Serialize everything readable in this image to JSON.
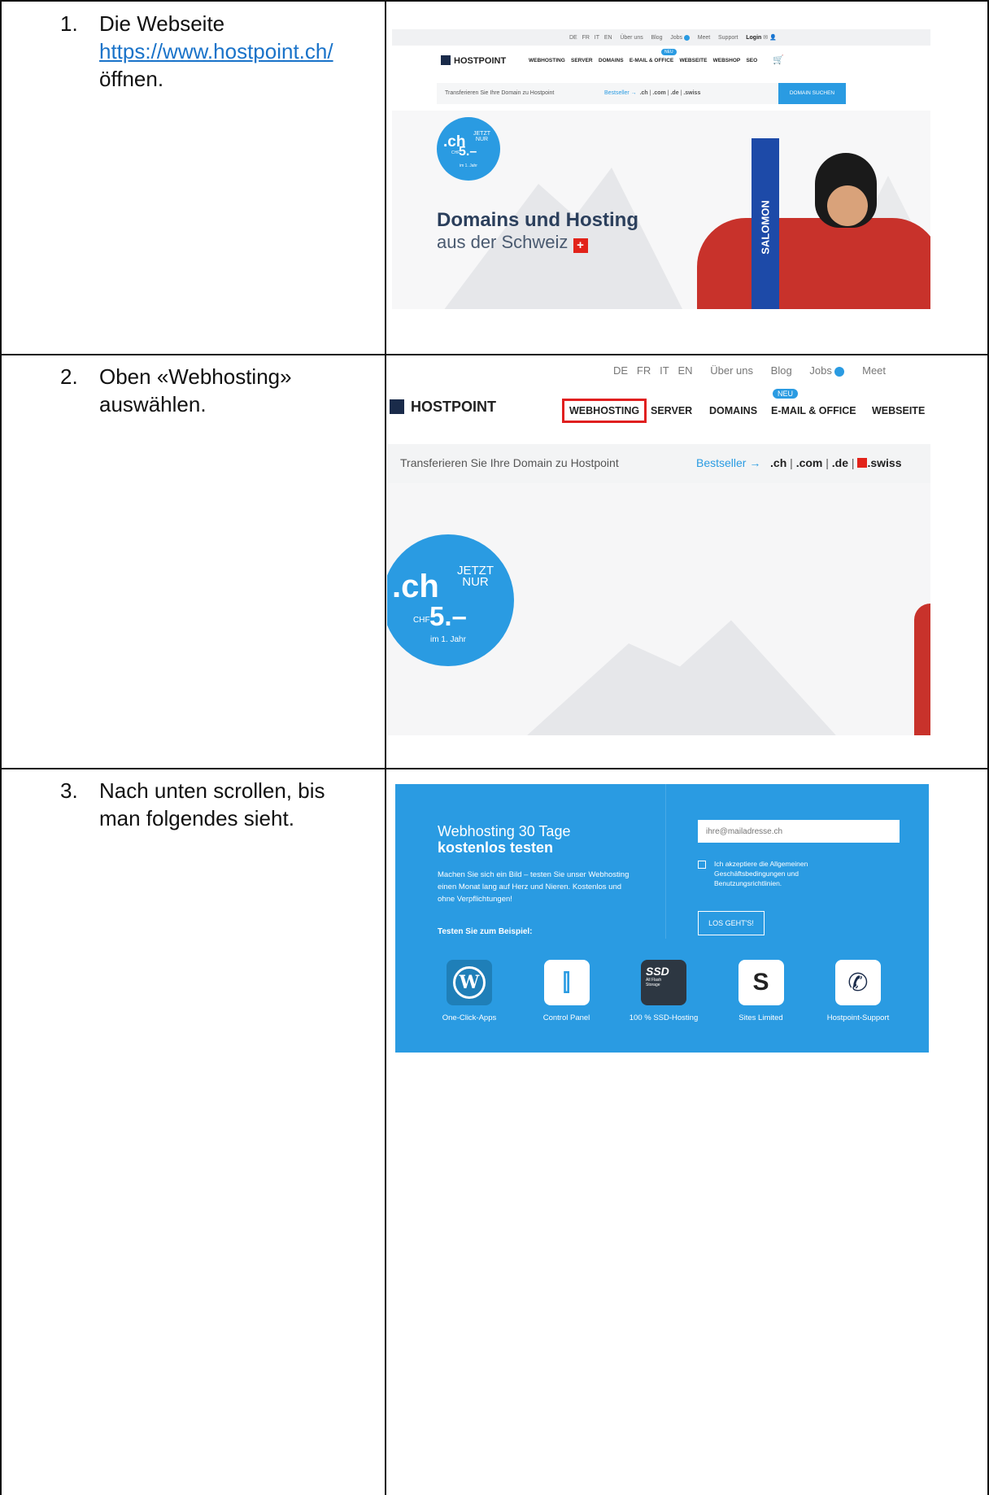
{
  "steps": [
    {
      "num": "1.",
      "line1": "Die Webseite",
      "link": "https://www.hostpoint.ch/",
      "line3": "öffnen."
    },
    {
      "num": "2.",
      "line1": "Oben «Webhosting»",
      "line2": "auswählen."
    },
    {
      "num": "3.",
      "line1": "Nach unten scrollen, bis",
      "line2": "man folgendes sieht."
    }
  ],
  "hostpoint": {
    "brand": "HOSTPOINT",
    "top_links": [
      "DE",
      "FR",
      "IT",
      "EN",
      "Über uns",
      "Blog",
      "Jobs",
      "Meet",
      "Support",
      "Login"
    ],
    "nav": [
      "WEBHOSTING",
      "SERVER",
      "DOMAINS",
      "E-MAIL & OFFICE",
      "WEBSEITE",
      "WEBSHOP",
      "SEO"
    ],
    "neu_badge": "NEU",
    "transfer_text": "Transferieren Sie Ihre Domain zu Hostpoint",
    "bestseller": "Bestseller →",
    "tlds": [
      ".ch",
      ".com",
      ".de",
      ".swiss"
    ],
    "domain_button": "DOMAIN SUCHEN",
    "promo_ch": ".ch",
    "promo_jetzt": "JETZT",
    "promo_nur": "NUR",
    "promo_chf": "CHF",
    "promo_price": "5.–",
    "promo_year": "im 1. Jahr",
    "hero_title": "Domains und Hosting",
    "hero_sub": "aus der Schweiz",
    "salomon": "SALOMON"
  },
  "trial": {
    "title_light": "Webhosting 30 Tage",
    "title_bold": "kostenlos testen",
    "desc": "Machen Sie sich ein Bild – testen Sie unser Webhosting einen Monat lang auf Herz und Nieren. Kostenlos und ohne Verpflichtungen!",
    "example": "Testen Sie zum Beispiel:",
    "email_placeholder": "ihre@mailadresse.ch",
    "terms": "Ich akzeptiere die Allgemeinen Geschäftsbedingungen und Benutzungsrichtlinien.",
    "button": "LOS GEHT'S!",
    "features": [
      {
        "label": "One-Click-Apps",
        "glyph": "W",
        "icon": "wordpress-icon"
      },
      {
        "label": "Control Panel",
        "glyph": "⫿",
        "icon": "control-panel-icon"
      },
      {
        "label": "100 % SSD-Hosting",
        "glyph": "SSD",
        "icon": "ssd-icon"
      },
      {
        "label": "Sites Limited",
        "glyph": "S",
        "icon": "sites-icon"
      },
      {
        "label": "Hostpoint-Support",
        "glyph": "✆",
        "icon": "phone-icon"
      }
    ],
    "ssd_sub": "All Flash Storage"
  }
}
